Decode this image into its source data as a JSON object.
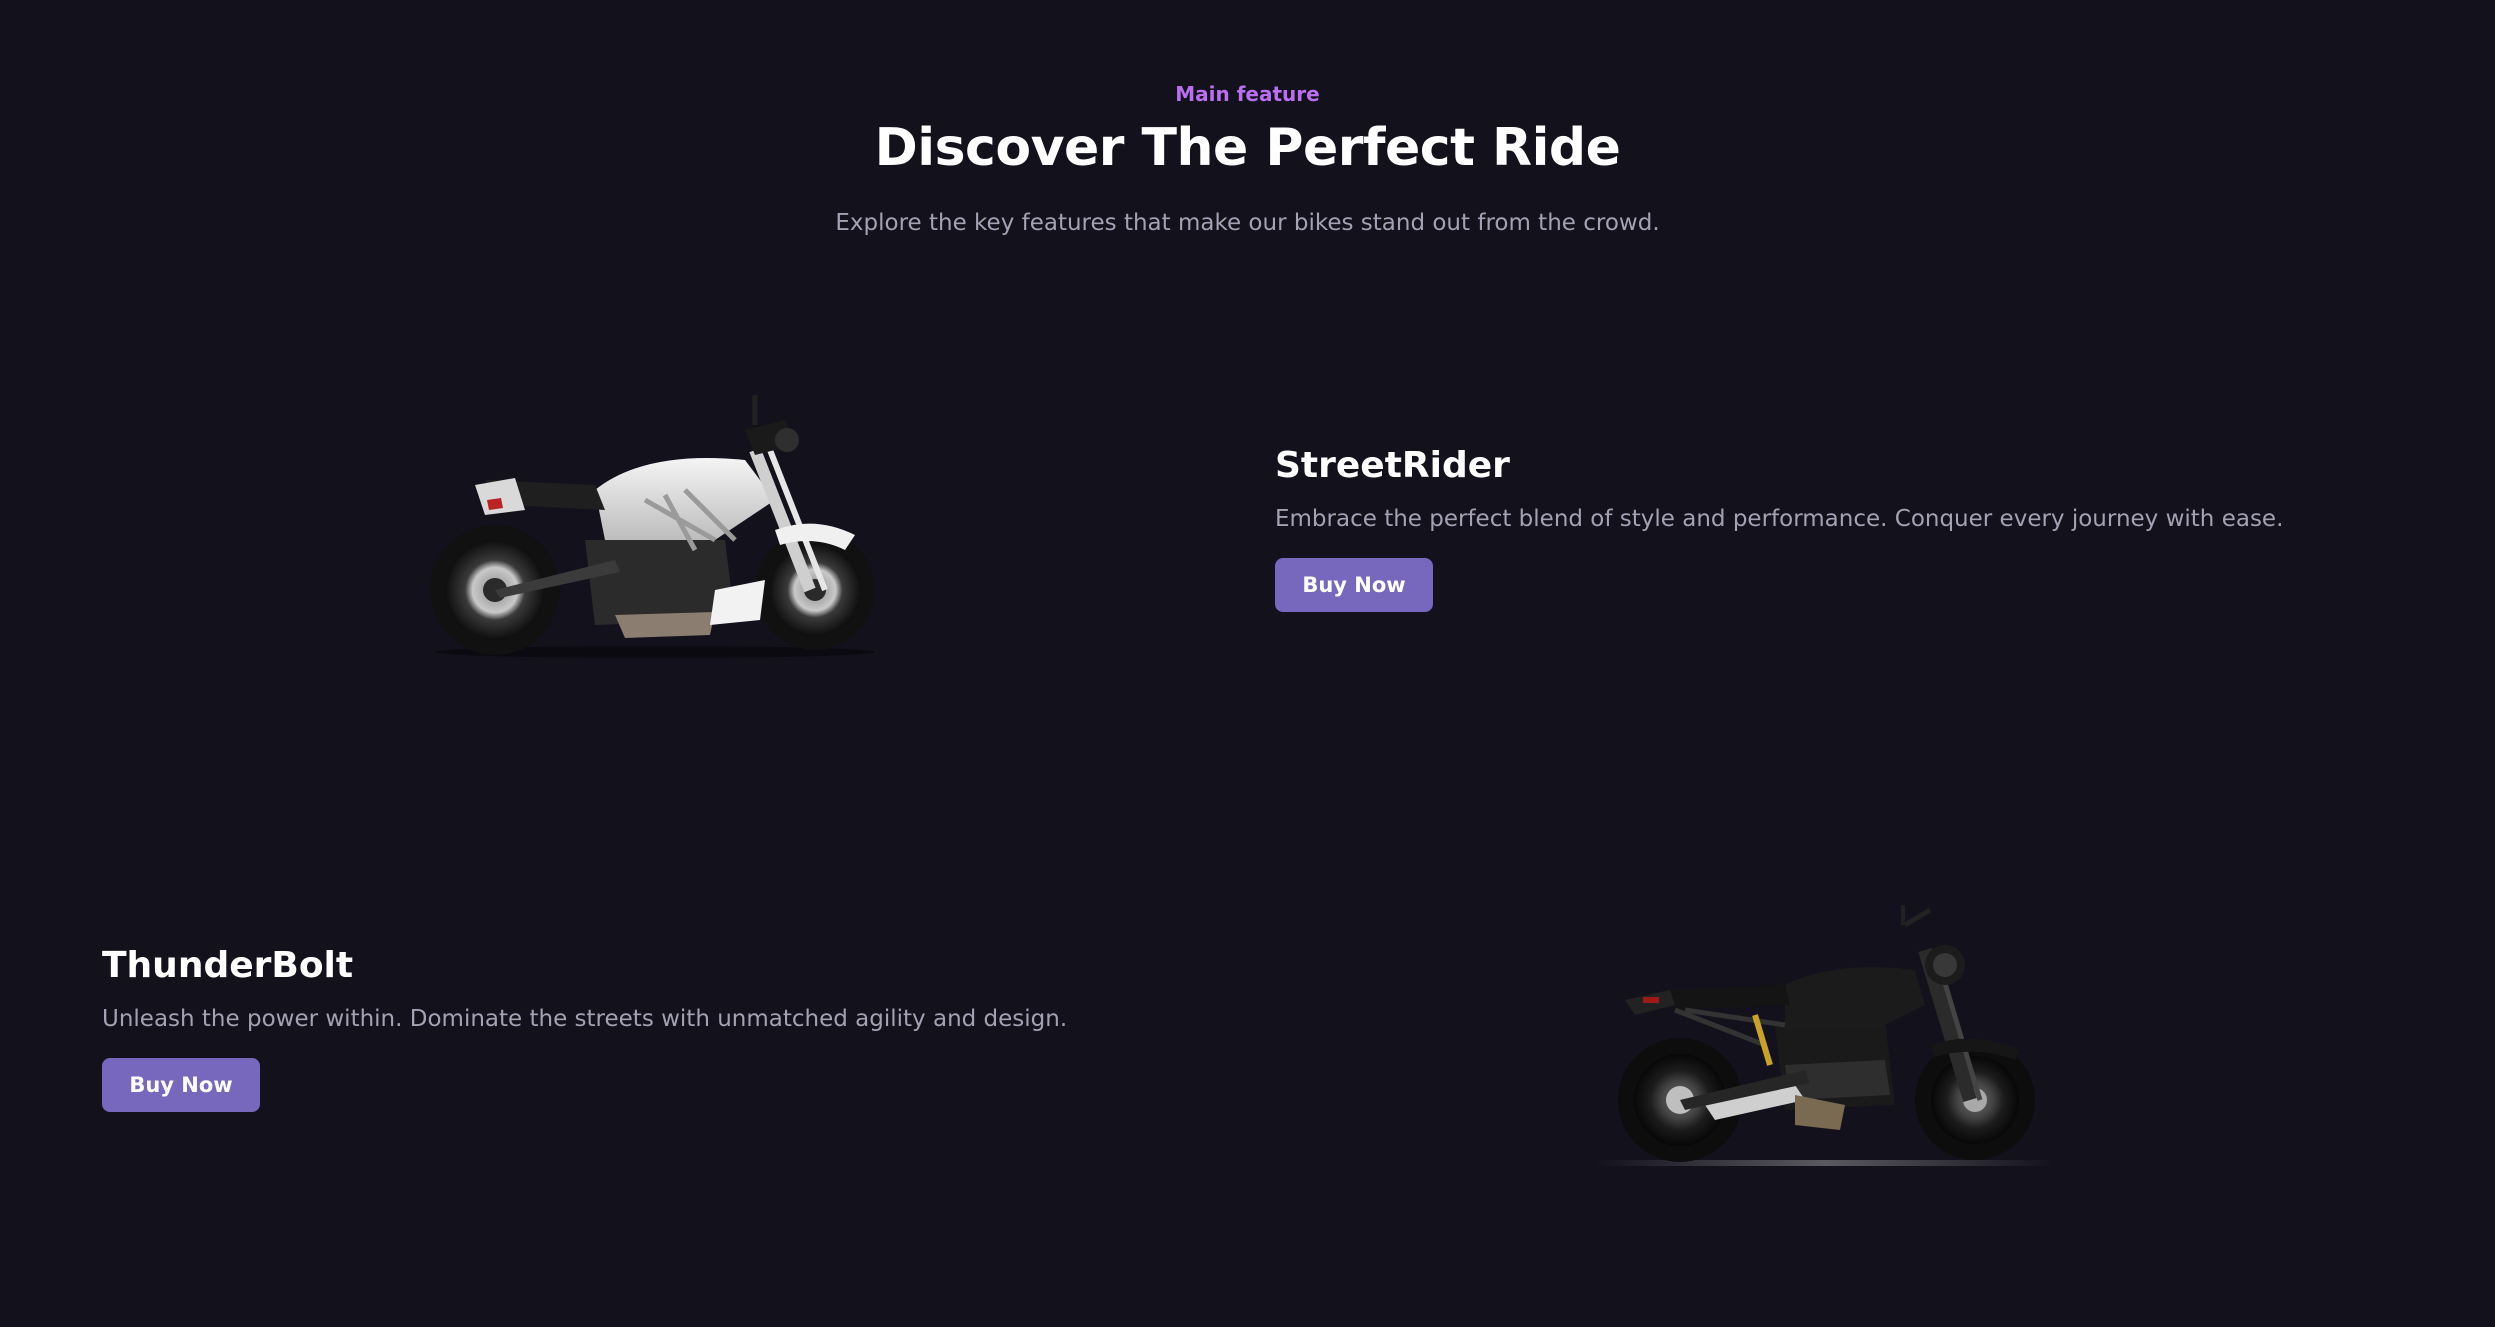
{
  "header": {
    "eyebrow": "Main feature",
    "title": "Discover The Perfect Ride",
    "subtitle": "Explore the key features that make our bikes stand out from the crowd."
  },
  "features": [
    {
      "name": "StreetRider",
      "description": "Embrace the perfect blend of style and performance. Conquer every journey with ease.",
      "button_label": "Buy Now",
      "image": "white-cruiser-motorcycle"
    },
    {
      "name": "ThunderBolt",
      "description": "Unleash the power within. Dominate the streets with unmatched agility and design.",
      "button_label": "Buy Now",
      "image": "black-naked-motorcycle"
    }
  ],
  "colors": {
    "background": "#13111c",
    "accent": "#b96ff0",
    "button": "#7768bd",
    "muted_text": "#a3a1b3"
  }
}
